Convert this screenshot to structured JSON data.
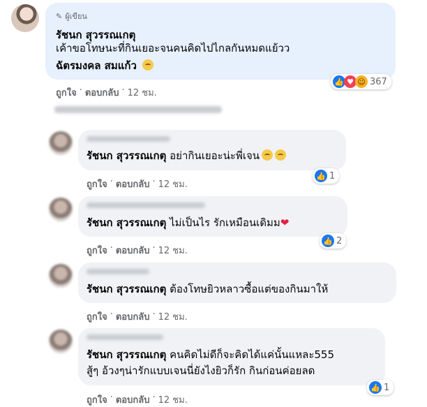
{
  "main_comment": {
    "badge": "ผู้เขียน",
    "author": "รัชนก สุวรรณเกตุ",
    "line1": "เค้าขอโทษนะที่กินเยอะจนคนคิดไปไกลกันหมดแย้วว",
    "line2_name": "ฉัตรมงคล สมแก้ว",
    "reaction_count": "367",
    "like_label": "ถูกใจ",
    "reply_label": "ตอบกลับ",
    "time": "12 ชม."
  },
  "replies": [
    {
      "author": "รัชนก สุวรรณเกตุ",
      "text": "อย่ากินเยอะน่ะพี่เจน",
      "reaction_count": "1",
      "like_label": "ถูกใจ",
      "reply_label": "ตอบกลับ",
      "time": "12 ชม."
    },
    {
      "author": "รัชนก สุวรรณเกตุ",
      "text": "ไม่เป็นไร รักเหมือนเดิมม",
      "reaction_count": "2",
      "like_label": "ถูกใจ",
      "reply_label": "ตอบกลับ",
      "time": "12 ชม."
    },
    {
      "author": "รัชนก สุวรรณเกตุ",
      "text": "ต้องโทษยิวหลาวซื้อแต่ของกินมาให้",
      "like_label": "ถูกใจ",
      "reply_label": "ตอบกลับ",
      "time": "12 ชม."
    },
    {
      "author": "รัชนก สุวรรณเกตุ",
      "text": "คนคิดไม่ดีก็จะคิดได้แค่นั้นแหละ555",
      "text2": "สู้ๆ อ้วงๆน่ารักแบบเจนนี่ยังไงยิวก็รัก กินก่อนค่อยลด",
      "reaction_count": "1",
      "like_label": "ถูกใจ",
      "reply_label": "ตอบกลับ",
      "time": "12 ชม."
    }
  ],
  "separator": "·",
  "icons": {
    "pen": "pen-icon",
    "like": "like-reaction-icon",
    "love": "love-reaction-icon",
    "haha": "haha-reaction-icon",
    "heart": "heart-emoji"
  }
}
